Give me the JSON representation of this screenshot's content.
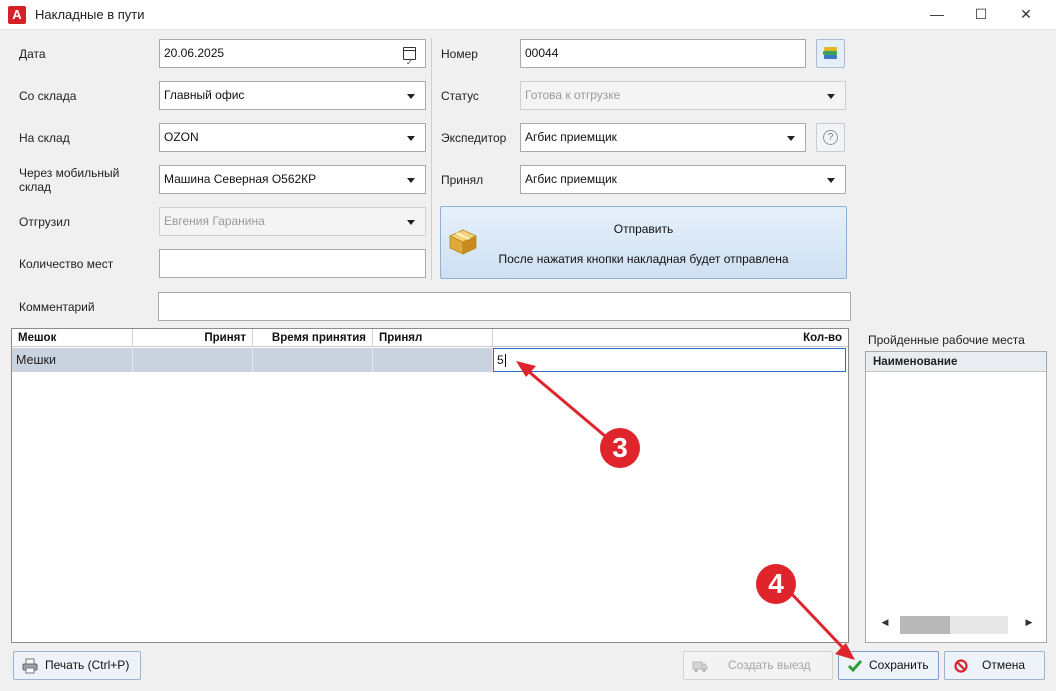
{
  "window": {
    "title": "Накладные в пути",
    "app_icon_letter": "A",
    "minimize": "—",
    "maximize": "☐",
    "close": "✕"
  },
  "form": {
    "date": {
      "label": "Дата",
      "value": "20.06.2025"
    },
    "from_warehouse": {
      "label": "Со склада",
      "value": "Главный офис"
    },
    "to_warehouse": {
      "label": "На склад",
      "value": "OZON"
    },
    "mobile_warehouse": {
      "label": "Через мобильный склад",
      "value": "Машина Северная О562КР"
    },
    "shipped_by": {
      "label": "Отгрузил",
      "value": "Евгения Гаранина"
    },
    "places_count": {
      "label": "Количество мест",
      "value": ""
    },
    "comment": {
      "label": "Комментарий",
      "value": ""
    },
    "number": {
      "label": "Номер",
      "value": "00044"
    },
    "status": {
      "label": "Статус",
      "value": "Готова к отгрузке"
    },
    "forwarder": {
      "label": "Экспедитор",
      "value": "Агбис приемщик"
    },
    "accepted_by": {
      "label": "Принял",
      "value": "Агбис приемщик"
    },
    "help_icon": "?"
  },
  "send_button": {
    "title": "Отправить",
    "subtitle": "После нажатия кнопки накладная будет отправлена"
  },
  "bags_table": {
    "columns": [
      "Мешок",
      "Принят",
      "Время принятия",
      "Принял",
      "Кол-во"
    ],
    "rows": [
      {
        "bag": "Мешки",
        "accepted": "",
        "accepted_time": "",
        "accepted_by": "",
        "qty": "5"
      }
    ]
  },
  "workplaces": {
    "title": "Пройденные рабочие места",
    "column": "Наименование"
  },
  "buttons": {
    "print": "Печать (Ctrl+P)",
    "create_trip": "Создать выезд",
    "save": "Сохранить",
    "cancel": "Отмена"
  },
  "annotations": {
    "step3": "3",
    "step4": "4",
    "color": "#e0242b"
  }
}
